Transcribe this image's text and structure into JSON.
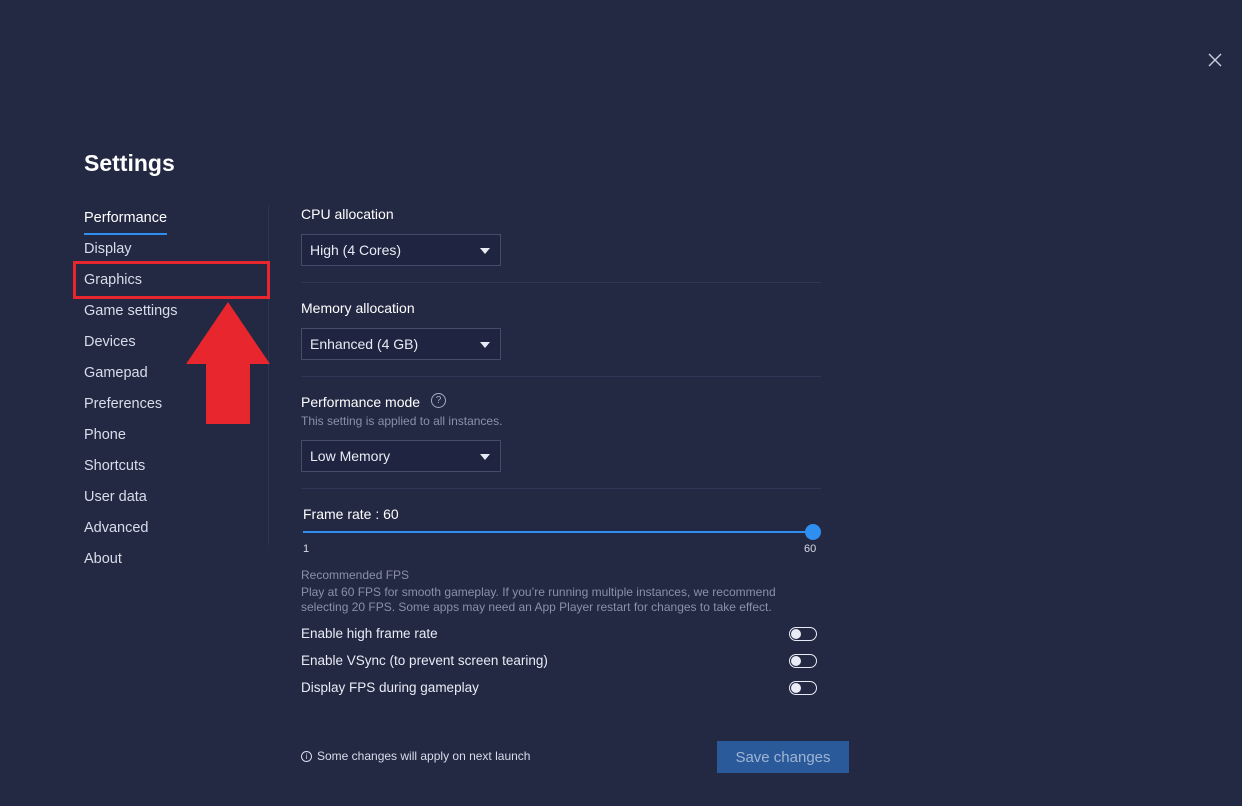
{
  "page_title": "Settings",
  "icons": {
    "close": "close-icon",
    "help": "question-circle-icon",
    "info": "info-circle-icon",
    "caret": "caret-down-icon"
  },
  "colors": {
    "background": "#232843",
    "accent": "#2f8ff0",
    "annotation": "#e8262e",
    "save_button": "#2b5a9a"
  },
  "sidebar": {
    "active": "Performance",
    "items": [
      {
        "label": "Performance"
      },
      {
        "label": "Display"
      },
      {
        "label": "Graphics"
      },
      {
        "label": "Game settings"
      },
      {
        "label": "Devices"
      },
      {
        "label": "Gamepad"
      },
      {
        "label": "Preferences"
      },
      {
        "label": "Phone"
      },
      {
        "label": "Shortcuts"
      },
      {
        "label": "User data"
      },
      {
        "label": "Advanced"
      },
      {
        "label": "About"
      }
    ]
  },
  "annotation": {
    "highlighted_item": "Graphics",
    "arrow": "red-up-arrow"
  },
  "performance": {
    "cpu": {
      "label": "CPU allocation",
      "value": "High (4 Cores)"
    },
    "memory": {
      "label": "Memory allocation",
      "value": "Enhanced (4 GB)"
    },
    "mode": {
      "label": "Performance mode",
      "sublabel": "This setting is applied to all instances.",
      "value": "Low Memory"
    },
    "frame_rate": {
      "label": "Frame rate : 60",
      "value": 60,
      "min": 1,
      "max": 60,
      "min_label": "1",
      "max_label": "60",
      "recommended_title": "Recommended FPS",
      "recommended_text": "Play at 60 FPS for smooth gameplay. If you’re running multiple instances, we recommend selecting 20 FPS. Some apps may need an App Player restart for changes to take effect."
    },
    "toggles": [
      {
        "label": "Enable high frame rate",
        "enabled": false
      },
      {
        "label": "Enable VSync (to prevent screen tearing)",
        "enabled": false
      },
      {
        "label": "Display FPS during gameplay",
        "enabled": false
      }
    ]
  },
  "footer": {
    "note": "Some changes will apply on next launch",
    "save_label": "Save changes"
  }
}
